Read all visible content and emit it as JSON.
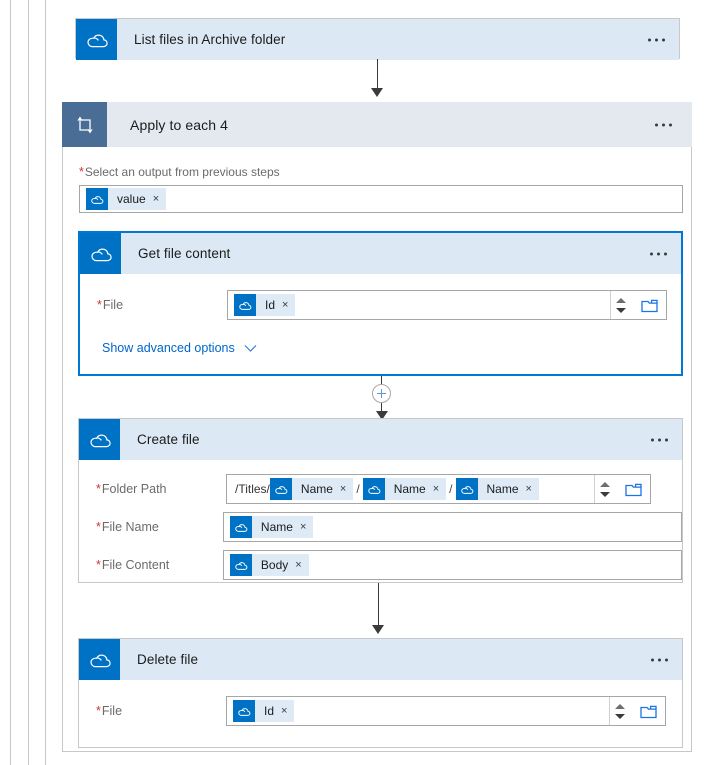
{
  "workflow": {
    "steps": [
      {
        "id": "list-files",
        "title": "List files in Archive folder",
        "icon": "onedrive-cloud-icon",
        "menu": "more-options"
      },
      {
        "id": "apply-to-each",
        "title": "Apply to each 4",
        "icon": "loop-icon",
        "menu": "more-options",
        "field": {
          "label": "Select an output from previous steps",
          "required": true,
          "tokens": [
            {
              "label": "value",
              "icon": "onedrive-cloud-icon",
              "remove": "×"
            }
          ]
        }
      },
      {
        "id": "get-file-content",
        "title": "Get file content",
        "icon": "onedrive-cloud-icon",
        "menu": "more-options",
        "selected": true,
        "fields": [
          {
            "label": "File",
            "required": true,
            "tokens": [
              {
                "label": "Id",
                "icon": "onedrive-cloud-icon",
                "remove": "×"
              }
            ],
            "has_spinner": true,
            "has_folder_picker": true
          }
        ],
        "advanced_options_label": "Show advanced options"
      },
      {
        "id": "create-file",
        "title": "Create file",
        "icon": "onedrive-cloud-icon",
        "menu": "more-options",
        "fields": [
          {
            "label": "Folder Path",
            "required": true,
            "prefix": "/Titles/",
            "tokens": [
              {
                "label": "Name",
                "icon": "onedrive-cloud-icon",
                "remove": "×"
              },
              {
                "label": "Name",
                "icon": "onedrive-cloud-icon",
                "remove": "×",
                "separator": "/"
              },
              {
                "label": "Name",
                "icon": "onedrive-cloud-icon",
                "remove": "×",
                "separator": "/"
              }
            ],
            "has_spinner": true,
            "has_folder_picker": true
          },
          {
            "label": "File Name",
            "required": true,
            "tokens": [
              {
                "label": "Name",
                "icon": "onedrive-cloud-icon",
                "remove": "×"
              }
            ]
          },
          {
            "label": "File Content",
            "required": true,
            "tokens": [
              {
                "label": "Body",
                "icon": "onedrive-cloud-icon",
                "remove": "×"
              }
            ]
          }
        ]
      },
      {
        "id": "delete-file",
        "title": "Delete file",
        "icon": "onedrive-cloud-icon",
        "menu": "more-options",
        "fields": [
          {
            "label": "File",
            "required": true,
            "tokens": [
              {
                "label": "Id",
                "icon": "onedrive-cloud-icon",
                "remove": "×"
              }
            ],
            "has_spinner": true,
            "has_folder_picker": true
          }
        ]
      }
    ],
    "add_step_button": "+",
    "colors": {
      "connector_brand": "#0072c6",
      "selected_border": "#0078d4",
      "header_bg": "#dce9f5",
      "loop_header_bg": "#e4e9f0",
      "loop_icon_bg": "#4a6d96",
      "required_marker": "#d13438",
      "link": "#0066cc",
      "token_bg": "#deebf7"
    }
  }
}
